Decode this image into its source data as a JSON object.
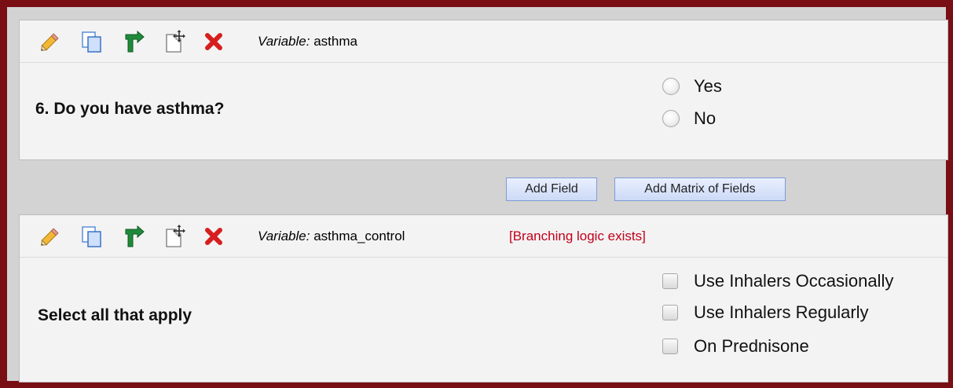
{
  "fields": [
    {
      "variable_label": "Variable:",
      "variable_name": "asthma",
      "branching_note": "",
      "question": "6. Do you have asthma?",
      "choice_type": "radio",
      "choices": [
        "Yes",
        "No"
      ]
    },
    {
      "variable_label": "Variable:",
      "variable_name": "asthma_control",
      "branching_note": "[Branching logic exists]",
      "question": "Select all that apply",
      "choice_type": "checkbox",
      "choices": [
        "Use Inhalers Occasionally",
        "Use Inhalers Regularly",
        "On Prednisone"
      ]
    }
  ],
  "add_bar": {
    "add_field_label": "Add Field",
    "add_matrix_label": "Add Matrix of Fields"
  },
  "toolbar_icons": [
    "pencil-icon",
    "copy-icon",
    "branching-icon",
    "move-icon",
    "delete-icon"
  ],
  "colors": {
    "frame_border": "#7a0e15",
    "branch_note": "#c0001b",
    "button_border": "#7f9bd6"
  }
}
